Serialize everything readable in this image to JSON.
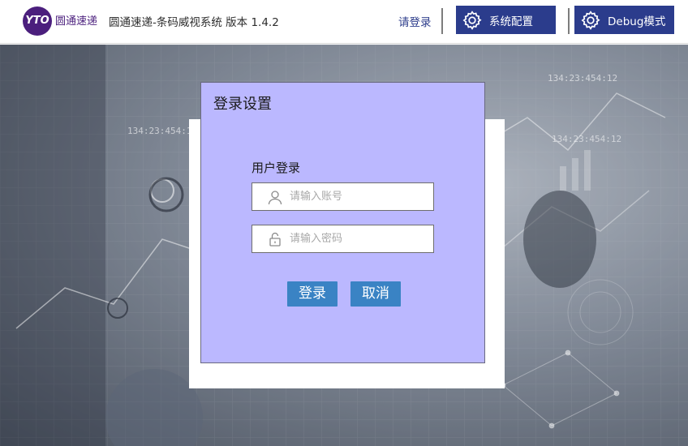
{
  "header": {
    "logo_badge": "YTO",
    "logo_text": "圆通速递",
    "title": "圆通速递-条码威视系统 版本 1.4.2",
    "login_link": "请登录",
    "config_button": "系统配置",
    "debug_button": "Debug模式"
  },
  "dialog": {
    "title": "登录设置",
    "section_label": "用户登录",
    "username_placeholder": "请输入账号",
    "password_placeholder": "请输入密码",
    "login_button": "登录",
    "cancel_button": "取消"
  },
  "background_texts": {
    "t1": "134:23:454:12",
    "t2": "134:23:454:12",
    "t3": "134:23:454:12"
  },
  "colors": {
    "header_button_bg": "#2b3c8c",
    "dialog_bg": "#bbb8ff",
    "action_button_bg": "#3a83c4",
    "logo_purple": "#4b1f7d"
  },
  "icons": {
    "config": "gear-icon",
    "debug": "gear-icon",
    "username": "user-icon",
    "password": "lock-icon"
  }
}
